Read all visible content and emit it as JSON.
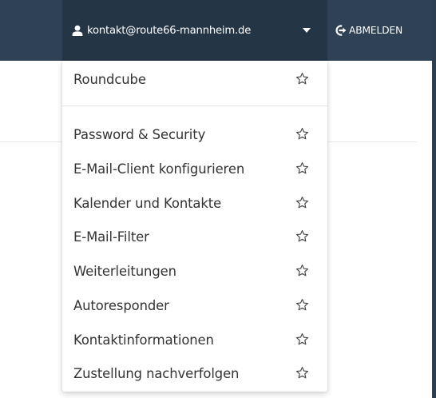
{
  "header": {
    "user_email": "kontakt@route66-mannheim.de",
    "logout_label": "ABMELDEN",
    "user_icon": "user-icon",
    "logout_icon": "sign-out-icon",
    "caret_icon": "caret-down-icon"
  },
  "dropdown": {
    "top_items": [
      {
        "label": "Roundcube",
        "icon": "star-outline-icon"
      }
    ],
    "items": [
      {
        "label": "Password & Security",
        "icon": "star-outline-icon"
      },
      {
        "label": "E-Mail-Client konfigurieren",
        "icon": "star-outline-icon"
      },
      {
        "label": "Kalender und Kontakte",
        "icon": "star-outline-icon"
      },
      {
        "label": "E-Mail-Filter",
        "icon": "star-outline-icon"
      },
      {
        "label": "Weiterleitungen",
        "icon": "star-outline-icon"
      },
      {
        "label": "Autoresponder",
        "icon": "star-outline-icon"
      },
      {
        "label": "Kontaktinformationen",
        "icon": "star-outline-icon"
      },
      {
        "label": "Zustellung nachverfolgen",
        "icon": "star-outline-icon"
      }
    ]
  },
  "colors": {
    "navbar": "#2f4154",
    "navbar_active": "#243545",
    "text": "#333333"
  }
}
